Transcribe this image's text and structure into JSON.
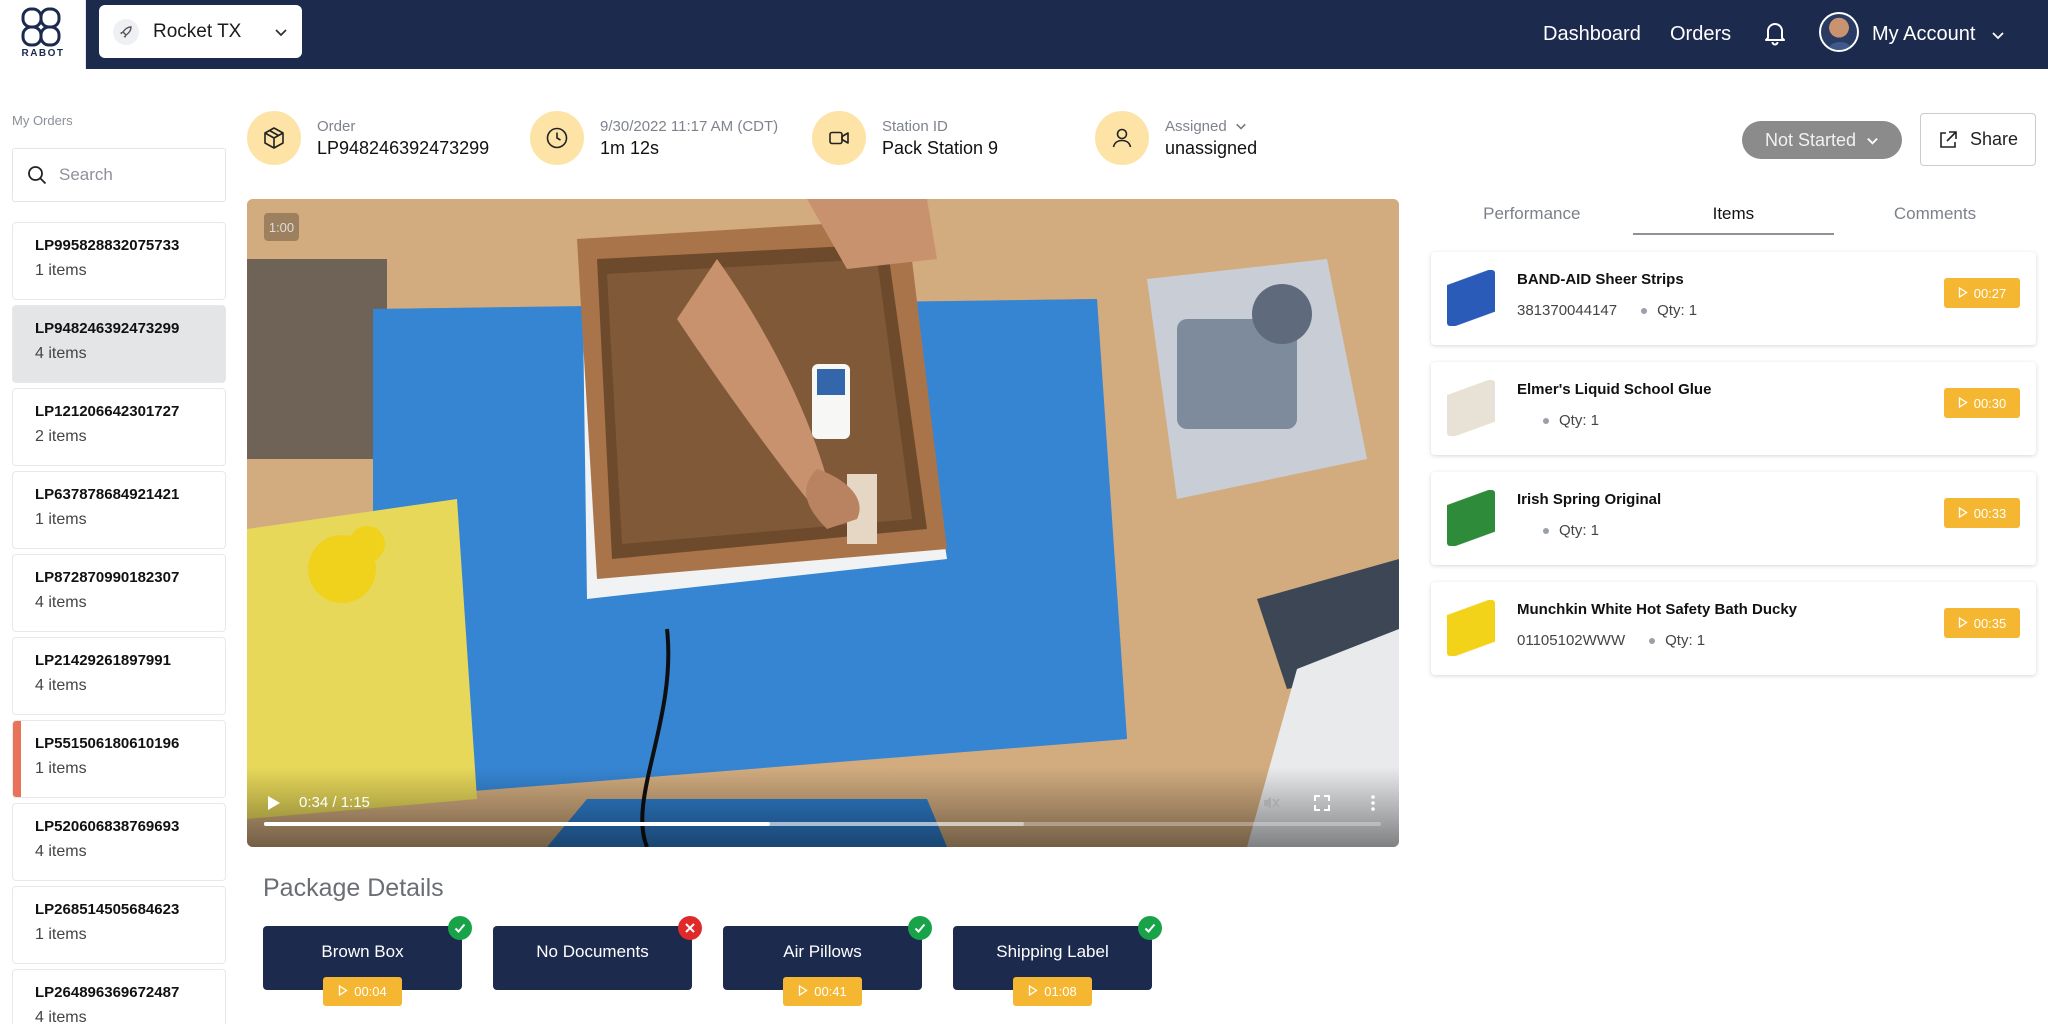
{
  "header": {
    "brand": "RABOT",
    "station_select": "Rocket TX",
    "nav": {
      "dashboard": "Dashboard",
      "orders": "Orders"
    },
    "account": "My Account"
  },
  "sidebar": {
    "heading": "My Orders",
    "search_placeholder": "Search",
    "orders": [
      {
        "id": "LP995828832075733",
        "count": "1 items"
      },
      {
        "id": "LP948246392473299",
        "count": "4 items",
        "active": true
      },
      {
        "id": "LP121206642301727",
        "count": "2 items"
      },
      {
        "id": "LP637878684921421",
        "count": "1 items"
      },
      {
        "id": "LP872870990182307",
        "count": "4 items"
      },
      {
        "id": "LP21429261897991",
        "count": "4 items"
      },
      {
        "id": "LP551506180610196",
        "count": "1 items",
        "flagged": true
      },
      {
        "id": "LP520606838769693",
        "count": "4 items"
      },
      {
        "id": "LP268514505684623",
        "count": "1 items"
      },
      {
        "id": "LP264896369672487",
        "count": "4 items"
      }
    ]
  },
  "info": {
    "order_label": "Order",
    "order_value": "LP948246392473299",
    "time_label": "9/30/2022 11:17 AM (CDT)",
    "time_value": "1m 12s",
    "station_label": "Station ID",
    "station_value": "Pack Station 9",
    "assigned_label": "Assigned",
    "assigned_value": "unassigned"
  },
  "actions": {
    "status": "Not Started",
    "share": "Share"
  },
  "video": {
    "badge": "1:00",
    "timecode": "0:34 / 1:15",
    "progress": 0.453,
    "buffered": 0.68
  },
  "package": {
    "title": "Package Details",
    "checks": [
      {
        "label": "Brown Box",
        "ok": true,
        "time": "00:04"
      },
      {
        "label": "No Documents",
        "ok": false,
        "time": ""
      },
      {
        "label": "Air Pillows",
        "ok": true,
        "time": "00:41"
      },
      {
        "label": "Shipping Label",
        "ok": true,
        "time": "01:08"
      }
    ]
  },
  "panel": {
    "tabs": [
      "Performance",
      "Items",
      "Comments"
    ],
    "active_tab": "Items",
    "items": [
      {
        "name": "BAND-AID Sheer Strips",
        "sku": "381370044147",
        "qty": "Qty: 1",
        "time": "00:27",
        "thumb_color": "#2a5bb8"
      },
      {
        "name": "Elmer's Liquid School Glue",
        "sku": "",
        "qty": "Qty: 1",
        "time": "00:30",
        "thumb_color": "#e8e2d6"
      },
      {
        "name": "Irish Spring Original",
        "sku": "",
        "qty": "Qty: 1",
        "time": "00:33",
        "thumb_color": "#2e8b3a"
      },
      {
        "name": "Munchkin White Hot Safety Bath Ducky",
        "sku": "01105102WWW",
        "qty": "Qty: 1",
        "time": "00:35",
        "thumb_color": "#f2d31a"
      }
    ]
  },
  "colors": {
    "navy": "#1c2a4d",
    "accent": "#f5b731",
    "ok": "#19a348",
    "error": "#e02a2a",
    "flag": "#e9735a"
  }
}
